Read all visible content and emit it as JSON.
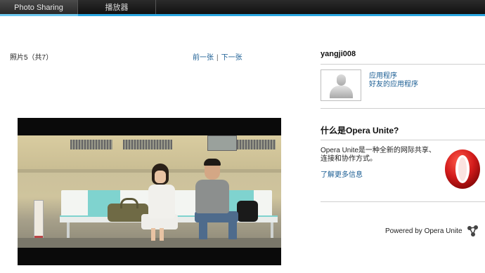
{
  "tabs": [
    {
      "label": "Photo Sharing",
      "active": true
    },
    {
      "label": "播放器",
      "active": false
    }
  ],
  "colors": {
    "accent": "#2aa6e0",
    "link": "#1a5d93",
    "opera_red": "#d21b1b"
  },
  "photo_viewer": {
    "counter": "照片5（共7）",
    "prev_label": "前一张",
    "separator": "|",
    "next_label": "下一张",
    "image": "photo of two people sitting on a bench"
  },
  "sidebar": {
    "username": "yangji008",
    "avatar_icon": "default-user-avatar-icon",
    "links": [
      {
        "label": "应用程序"
      },
      {
        "label": "好友的应用程序"
      }
    ],
    "about": {
      "title": "什么是Opera Unite?",
      "description": "Opera Unite是一种全新的网际共享、连接和协作方式。",
      "learn_more": "了解更多信息",
      "logo_icon": "opera-logo-icon"
    },
    "powered_by": "Powered by Opera Unite",
    "powered_icon": "opera-unite-icon"
  }
}
